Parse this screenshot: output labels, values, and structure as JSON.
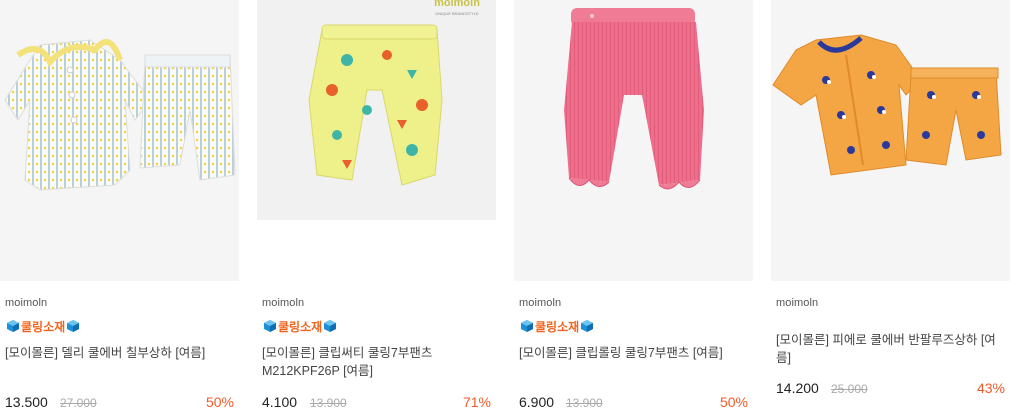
{
  "products": [
    {
      "brand": "moimoln",
      "badge": "쿨링소재",
      "title": "[모이몰른] 델리 쿨에버 칠부상하 [여름]",
      "price": "13.500",
      "original_price": "27.000",
      "discount": "50%",
      "bg_color": "#f5f5f5"
    },
    {
      "brand": "moimoln",
      "badge": "쿨링소재",
      "title": "[모이몰른] 클립써티 쿨링7부팬츠 M212KPF26P [여름]",
      "price": "4.100",
      "original_price": "13.900",
      "discount": "71%",
      "bg_color": "#f1f1f1",
      "image_logo": "moimoln",
      "image_logo_sub": "UNIQUE BRANDSTYLE"
    },
    {
      "brand": "moimoln",
      "badge": "쿨링소재",
      "title": "[모이몰른] 클립롤링 쿨링7부팬츠 [여름]",
      "price": "6.900",
      "original_price": "13.900",
      "discount": "50%",
      "bg_color": "#f5f5f5"
    },
    {
      "brand": "moimoln",
      "title": "[모이몰른] 피에로 쿨에버 반팔루즈상하 [여름]",
      "price": "14.200",
      "original_price": "25.000",
      "discount": "43%",
      "bg_color": "#f5f5f5"
    }
  ],
  "colors": {
    "badge": "#f0641e",
    "discount": "#f05a28",
    "cube_icon": "#1e90d6"
  }
}
